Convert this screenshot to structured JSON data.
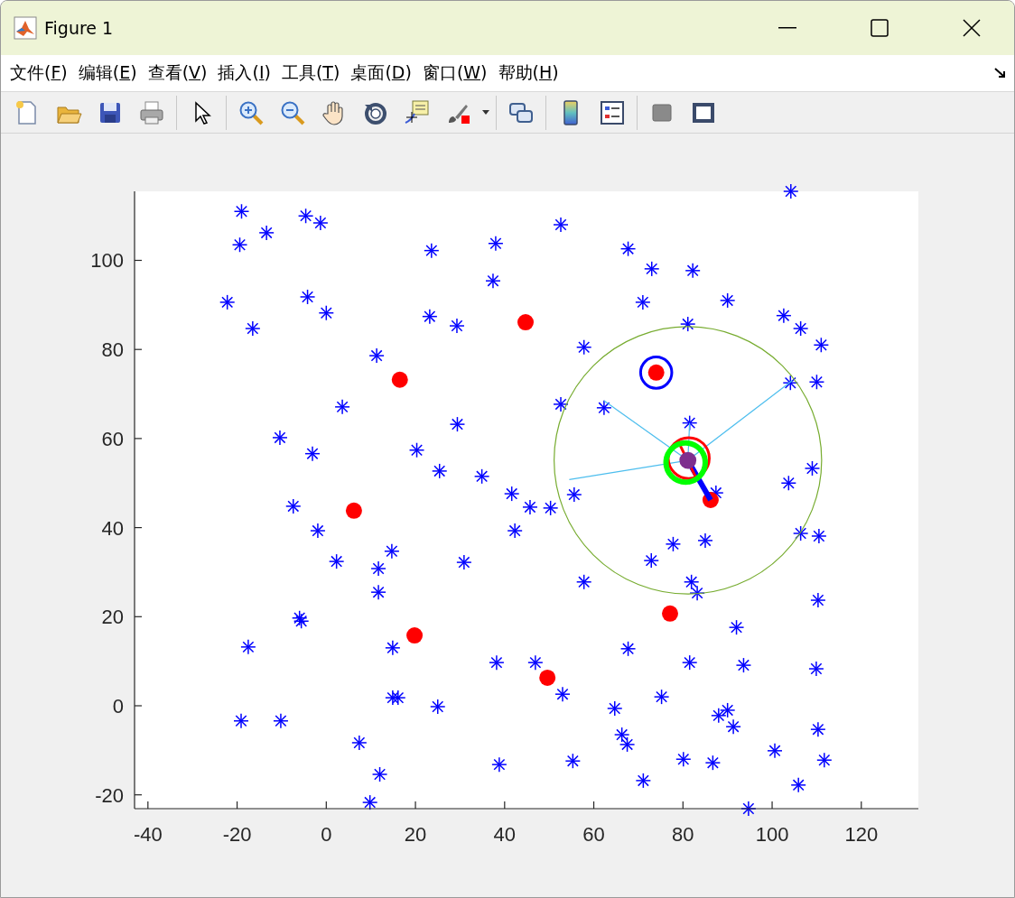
{
  "window": {
    "title": "Figure 1"
  },
  "menu": [
    "文件(F)",
    "编辑(E)",
    "查看(V)",
    "插入(I)",
    "工具(T)",
    "桌面(D)",
    "窗口(W)",
    "帮助(H)"
  ],
  "toolbar": [
    {
      "kind": "new"
    },
    {
      "kind": "open"
    },
    {
      "kind": "save"
    },
    {
      "kind": "print"
    },
    {
      "kind": "sep"
    },
    {
      "kind": "pointer"
    },
    {
      "kind": "sep"
    },
    {
      "kind": "zoomin"
    },
    {
      "kind": "zoomout"
    },
    {
      "kind": "pan"
    },
    {
      "kind": "rotate"
    },
    {
      "kind": "cursor"
    },
    {
      "kind": "brush"
    },
    {
      "kind": "sep"
    },
    {
      "kind": "link"
    },
    {
      "kind": "sep"
    },
    {
      "kind": "colorbar"
    },
    {
      "kind": "legend"
    },
    {
      "kind": "sep"
    },
    {
      "kind": "square"
    },
    {
      "kind": "frame"
    }
  ],
  "plot": {
    "chart_data": {
      "type": "scatter",
      "xlim": [
        -43,
        132.8
      ],
      "ylim": [
        -23.1,
        115.5
      ],
      "xticks": [
        -40,
        -20,
        0,
        20,
        40,
        60,
        80,
        100,
        120
      ],
      "yticks": [
        -20,
        0,
        20,
        40,
        60,
        80,
        100
      ],
      "series": [
        {
          "color": "#0000ff",
          "marker": "cross",
          "x": [
            -19,
            -19.4,
            -13.4,
            -4.6,
            -1.3,
            -22.2,
            -16.5,
            -4.2,
            0,
            11.3,
            3.6,
            -10.4,
            -3.1,
            -7.4,
            -1.9,
            2.3,
            11.7,
            14.7,
            11.7,
            -6,
            -5.6,
            -17.5,
            14.9,
            -19.1,
            -10.2,
            14.9,
            16.1,
            7.4,
            12,
            9.8,
            23.6,
            23.2,
            29.3,
            37.4,
            38,
            52.6,
            20.3,
            25.4,
            29.4,
            34.9,
            41.6,
            45.7,
            42.3,
            50.3,
            30.9,
            38.2,
            46.9,
            53,
            25,
            38.8,
            55.3,
            52.6,
            57.8,
            62.3,
            55.6,
            57.8,
            67.7,
            73,
            82.2,
            71,
            90,
            81.1,
            102.6,
            106.4,
            111,
            104.1,
            110,
            81.5,
            87.4,
            103.7,
            109,
            106.4,
            110.5,
            77.8,
            72.9,
            85,
            81.9,
            83.2,
            67.7,
            81.5,
            92,
            93.6,
            110.3,
            109.9,
            64.7,
            75.2,
            66.3,
            67.5,
            71.1,
            80.1,
            86.7,
            88,
            90,
            91.3,
            100.6,
            105.9,
            110.3,
            111.7,
            94.7,
            104.2
          ],
          "values": [
            111,
            103.5,
            106.2,
            110,
            108.4,
            90.6,
            84.7,
            91.8,
            88.2,
            78.6,
            67.1,
            60.2,
            56.6,
            44.8,
            39.3,
            32.4,
            30.8,
            34.7,
            25.5,
            19.7,
            19,
            13.2,
            13,
            -3.4,
            -3.4,
            1.8,
            1.8,
            -8.3,
            -15.4,
            -21.7,
            102.2,
            87.4,
            85.3,
            95.4,
            103.8,
            108,
            57.4,
            52.7,
            63.2,
            51.5,
            47.6,
            44.6,
            39.3,
            44.4,
            32.2,
            9.7,
            9.7,
            2.6,
            -0.2,
            -13.2,
            -12.4,
            67.7,
            80.5,
            66.9,
            47.4,
            27.8,
            102.6,
            98.1,
            97.7,
            90.6,
            91,
            85.7,
            87.6,
            84.7,
            81,
            72.5,
            72.7,
            63.5,
            47.8,
            50,
            53.3,
            38.7,
            38.1,
            36.3,
            32.6,
            37.1,
            27.8,
            25.3,
            12.8,
            9.7,
            17.6,
            9.1,
            23.7,
            8.3,
            -0.6,
            2,
            -6.5,
            -8.7,
            -16.8,
            -12,
            -12.8,
            -2.2,
            -1,
            -4.7,
            -10.1,
            -17.8,
            -5.3,
            -12.2,
            -23.1,
            115.5
          ]
        },
        {
          "color": "#ff0000",
          "marker": "dot",
          "x": [
            44.7,
            16.5,
            6.2,
            19.8,
            49.6,
            77.1,
            86.2,
            74
          ],
          "values": [
            86.1,
            73.2,
            43.8,
            15.8,
            6.3,
            20.7,
            46.2,
            74.8
          ]
        }
      ]
    }
  }
}
